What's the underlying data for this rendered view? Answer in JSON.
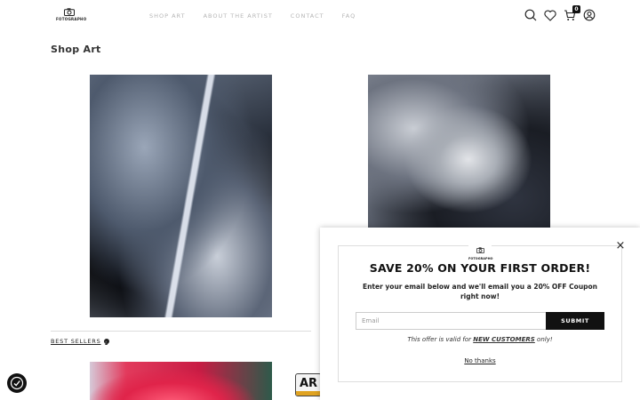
{
  "header": {
    "logo_text": "FOTOGRAPHO",
    "nav": [
      "SHOP ART",
      "ABOUT THE ARTIST",
      "CONTACT",
      "FAQ"
    ],
    "cart_count": "0",
    "icons": [
      "search-icon",
      "heart-icon",
      "cart-icon",
      "account-icon"
    ]
  },
  "main": {
    "page_title": "Shop Art",
    "best_sellers_label": "BEST SELLERS",
    "ar_badge_text": "AR"
  },
  "popup": {
    "logo_text": "FOTOGRAPHO",
    "close_label": "×",
    "headline": "SAVE 20% ON YOUR FIRST ORDER!",
    "subtext": "Enter your email below and we'll email you a 20% OFF Coupon right now!",
    "email_placeholder": "Email",
    "submit_label": "SUBMIT",
    "offer_prefix": "This offer is valid for ",
    "offer_highlight": "NEW CUSTOMERS",
    "offer_suffix": " only!",
    "no_thanks_label": "No thanks"
  },
  "colors": {
    "accent": "#111111",
    "nav_text": "#b5b5b5"
  }
}
